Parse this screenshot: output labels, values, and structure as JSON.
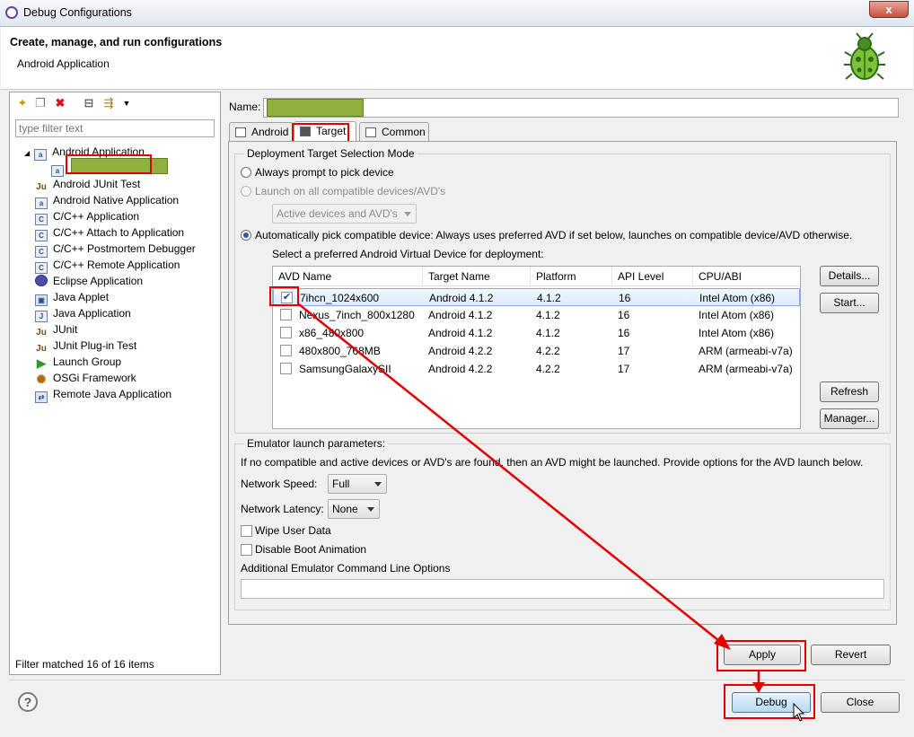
{
  "window": {
    "title": "Debug Configurations",
    "close_glyph": "x"
  },
  "header": {
    "title": "Create, manage, and run configurations",
    "subtitle": "Android Application"
  },
  "left": {
    "filter_placeholder": "type filter text",
    "tree": [
      {
        "label": "Android Application",
        "icon": "android-app-icon",
        "expanded": true
      },
      {
        "label": "",
        "icon": "android-config-icon",
        "child": true
      },
      {
        "label": "Android JUnit Test",
        "icon": "junit-icon"
      },
      {
        "label": "Android Native Application",
        "icon": "android-native-icon"
      },
      {
        "label": "C/C++ Application",
        "icon": "c-app-icon"
      },
      {
        "label": "C/C++ Attach to Application",
        "icon": "c-attach-icon"
      },
      {
        "label": "C/C++ Postmortem Debugger",
        "icon": "c-postmortem-icon"
      },
      {
        "label": "C/C++ Remote Application",
        "icon": "c-remote-icon"
      },
      {
        "label": "Eclipse Application",
        "icon": "eclipse-icon"
      },
      {
        "label": "Java Applet",
        "icon": "java-applet-icon"
      },
      {
        "label": "Java Application",
        "icon": "java-app-icon"
      },
      {
        "label": "JUnit",
        "icon": "junit-icon"
      },
      {
        "label": "JUnit Plug-in Test",
        "icon": "junit-plugin-icon"
      },
      {
        "label": "Launch Group",
        "icon": "launch-group-icon"
      },
      {
        "label": "OSGi Framework",
        "icon": "osgi-icon"
      },
      {
        "label": "Remote Java Application",
        "icon": "remote-java-icon"
      }
    ],
    "status": "Filter matched 16 of 16 items"
  },
  "main": {
    "name_label": "Name:",
    "name_value": "",
    "tabs": [
      {
        "label": "Android"
      },
      {
        "label": "Target"
      },
      {
        "label": "Common"
      }
    ],
    "deploy": {
      "legend": "Deployment Target Selection Mode",
      "opt_prompt": "Always prompt to pick device",
      "opt_launch_all": "Launch on all compatible devices/AVD's",
      "combo_all": "Active devices and AVD's",
      "opt_auto": "Automatically pick compatible device: Always uses preferred AVD if set below, launches on compatible device/AVD otherwise.",
      "avd_prompt": "Select a preferred Android Virtual Device for deployment:"
    },
    "avd_table": {
      "columns": [
        "AVD Name",
        "Target Name",
        "Platform",
        "API Level",
        "CPU/ABI"
      ],
      "rows": [
        {
          "name": "7ihcn_1024x600",
          "target": "Android 4.1.2",
          "platform": "4.1.2",
          "api": "16",
          "abi": "Intel Atom (x86)",
          "checked": true
        },
        {
          "name": "Nexus_7inch_800x1280",
          "target": "Android 4.1.2",
          "platform": "4.1.2",
          "api": "16",
          "abi": "Intel Atom (x86)",
          "checked": false
        },
        {
          "name": "x86_480x800",
          "target": "Android 4.1.2",
          "platform": "4.1.2",
          "api": "16",
          "abi": "Intel Atom (x86)",
          "checked": false
        },
        {
          "name": "480x800_768MB",
          "target": "Android 4.2.2",
          "platform": "4.2.2",
          "api": "17",
          "abi": "ARM (armeabi-v7a)",
          "checked": false
        },
        {
          "name": "SamsungGalaxySII",
          "target": "Android 4.2.2",
          "platform": "4.2.2",
          "api": "17",
          "abi": "ARM (armeabi-v7a)",
          "checked": false
        }
      ],
      "buttons": {
        "details": "Details...",
        "start": "Start...",
        "refresh": "Refresh",
        "manager": "Manager..."
      }
    },
    "emulator": {
      "legend": "Emulator launch parameters:",
      "info": "If no compatible and active devices or AVD's are found, then an AVD might be launched. Provide options for the AVD launch below.",
      "speed_label": "Network Speed:",
      "speed_value": "Full",
      "latency_label": "Network Latency:",
      "latency_value": "None",
      "wipe": "Wipe User Data",
      "disable_boot": "Disable Boot Animation",
      "cmdline_label": "Additional Emulator Command Line Options",
      "cmdline_value": ""
    },
    "apply": "Apply",
    "revert": "Revert"
  },
  "footer": {
    "help": "?",
    "debug": "Debug",
    "close": "Close"
  },
  "colors": {
    "annotation_red": "#e10000",
    "redacted_green": "#8faf3e"
  }
}
